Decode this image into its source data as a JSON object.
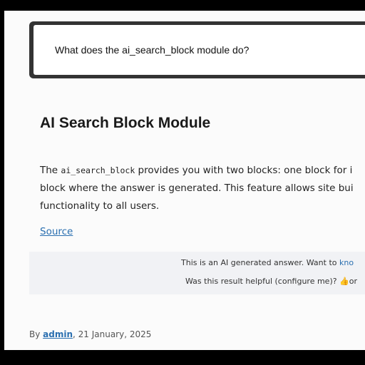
{
  "search": {
    "query": "What does the ai_search_block module do?"
  },
  "article": {
    "title": "AI Search Block Module",
    "body_prefix": "The ",
    "body_code": "ai_search_block",
    "body_line1_rest": " provides you with two blocks: one block for i",
    "body_line2": "block where the answer is generated. This feature allows site bui",
    "body_line3": "functionality to all users.",
    "source_label": "Source"
  },
  "ai_notice": {
    "line1_text": "This is an AI generated answer. Want to ",
    "line1_link": "kno",
    "line2_text": "Was this result helpful (configure me)? ",
    "thumb_glyph": "👍",
    "line2_tail": "or"
  },
  "byline": {
    "prefix": "By ",
    "author": "admin",
    "date": ", 21 January, 2025"
  }
}
